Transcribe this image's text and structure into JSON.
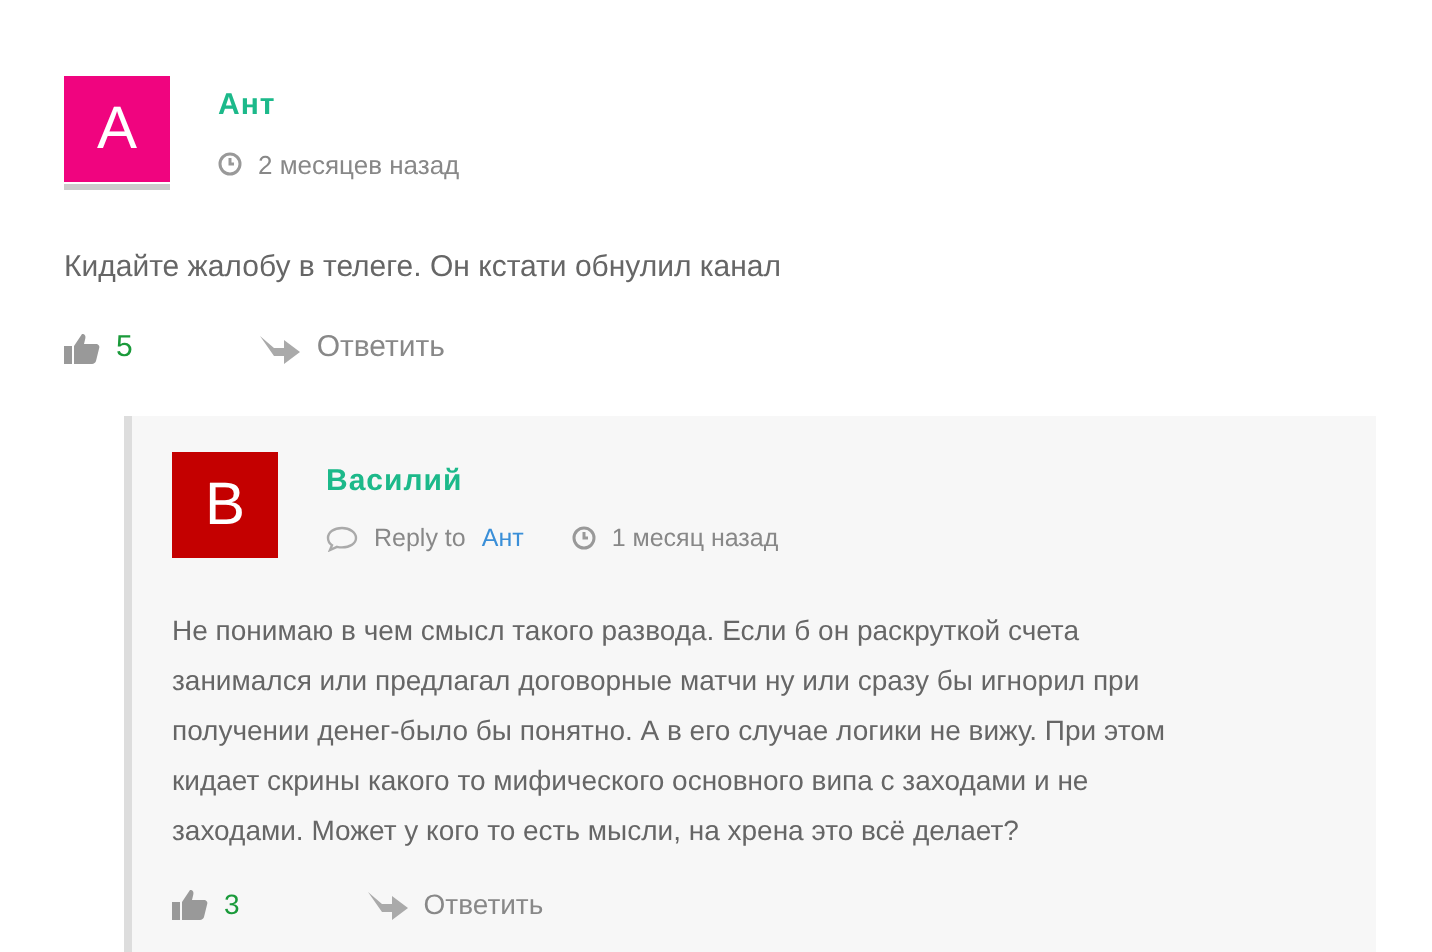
{
  "comments": [
    {
      "avatar_letter": "А",
      "color": "#f0047f",
      "author": "Ант",
      "time": "2 месяцев назад",
      "text": "Кидайте жалобу в телеге. Он кстати обнулил канал",
      "likes": "5",
      "reply_label": "Ответить",
      "replies": [
        {
          "avatar_letter": "В",
          "color": "#c40000",
          "author": "Василий",
          "reply_to_label": "Reply to",
          "reply_to": "Ант",
          "time": "1 месяц назад",
          "text": "Не понимаю в чем смысл такого развода. Если б он раскруткой счета занимался или предлагал договорные матчи ну или сразу бы игнорил при получении денег-было бы понятно. А в его случае логики не вижу. При этом кидает скрины какого то мифического основного випа с заходами и не заходами. Может у кого то есть мысли, на хрена это всё делает?",
          "likes": "3",
          "reply_label": "Ответить"
        }
      ]
    }
  ]
}
